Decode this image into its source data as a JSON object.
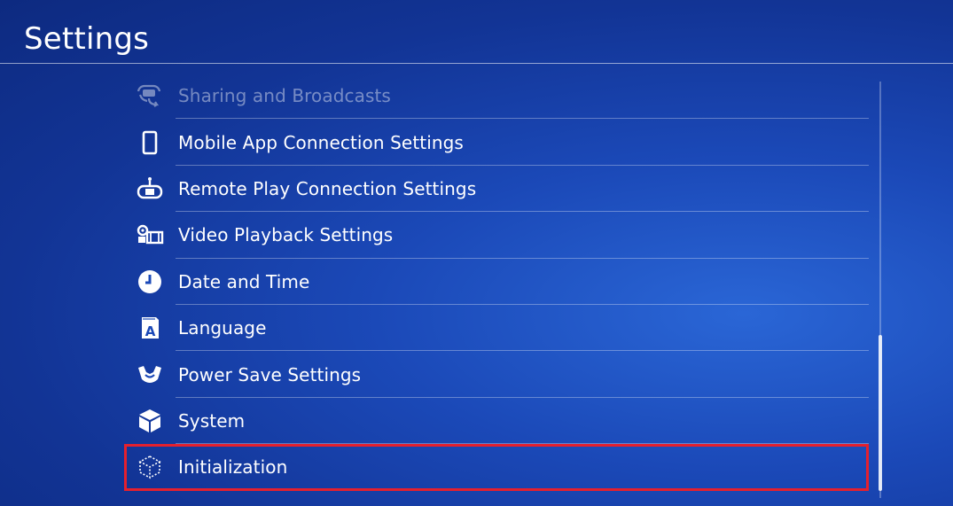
{
  "header": {
    "title": "Settings"
  },
  "menu": {
    "items": [
      {
        "label": "Sharing and Broadcasts",
        "icon": "sharing-icon"
      },
      {
        "label": "Mobile App Connection Settings",
        "icon": "mobile-phone-icon"
      },
      {
        "label": "Remote Play Connection Settings",
        "icon": "remote-play-icon"
      },
      {
        "label": "Video Playback Settings",
        "icon": "video-playback-icon"
      },
      {
        "label": "Date and Time",
        "icon": "clock-icon"
      },
      {
        "label": "Language",
        "icon": "language-icon"
      },
      {
        "label": "Power Save Settings",
        "icon": "power-save-icon"
      },
      {
        "label": "System",
        "icon": "system-cube-icon"
      },
      {
        "label": "Initialization",
        "icon": "initialization-icon"
      }
    ]
  },
  "colors": {
    "background": "#1b49b8",
    "highlight_border": "#e5202e",
    "text": "#ffffff"
  }
}
